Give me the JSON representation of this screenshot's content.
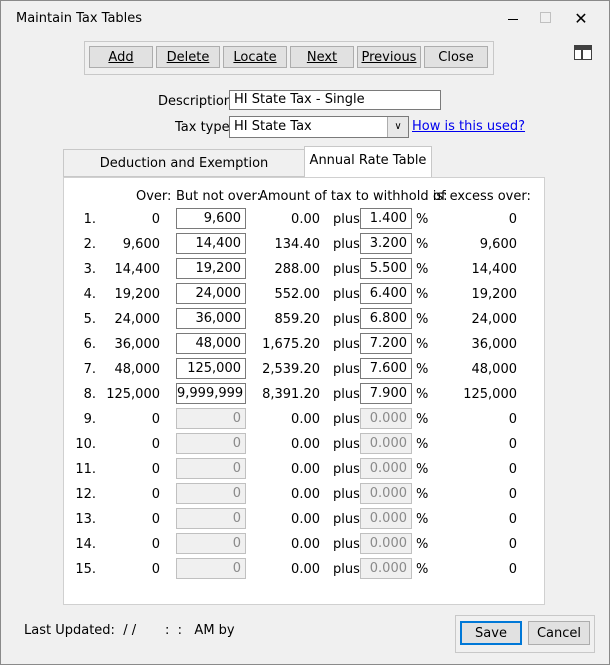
{
  "window": {
    "title": "Maintain Tax Tables",
    "close_glyph": "✕"
  },
  "toolbar": {
    "add": "Add",
    "delete": "Delete",
    "locate": "Locate",
    "next": "Next",
    "previous": "Previous",
    "close": "Close"
  },
  "form": {
    "description_label": "Description:",
    "description_value": "HI State Tax - Single",
    "tax_type_label": "Tax type:",
    "tax_type_value": "HI State Tax",
    "how_used_link": "How is this used?"
  },
  "tabs": [
    {
      "label": "Deduction and Exemption Information",
      "active": false
    },
    {
      "label": "Annual Rate Table",
      "active": true
    }
  ],
  "rate_table": {
    "headers": {
      "over": "Over:",
      "but_not_over": "But not over:",
      "amount": "Amount of tax to withhold is:",
      "of_excess": "of excess over:"
    },
    "plus_label": "plus",
    "percent_label": "%",
    "rows": [
      {
        "num": "1.",
        "over": "0",
        "not_over": "9,600",
        "amount": "0.00",
        "rate": "1.400",
        "excess": "0",
        "enabled": true
      },
      {
        "num": "2.",
        "over": "9,600",
        "not_over": "14,400",
        "amount": "134.40",
        "rate": "3.200",
        "excess": "9,600",
        "enabled": true
      },
      {
        "num": "3.",
        "over": "14,400",
        "not_over": "19,200",
        "amount": "288.00",
        "rate": "5.500",
        "excess": "14,400",
        "enabled": true
      },
      {
        "num": "4.",
        "over": "19,200",
        "not_over": "24,000",
        "amount": "552.00",
        "rate": "6.400",
        "excess": "19,200",
        "enabled": true
      },
      {
        "num": "5.",
        "over": "24,000",
        "not_over": "36,000",
        "amount": "859.20",
        "rate": "6.800",
        "excess": "24,000",
        "enabled": true
      },
      {
        "num": "6.",
        "over": "36,000",
        "not_over": "48,000",
        "amount": "1,675.20",
        "rate": "7.200",
        "excess": "36,000",
        "enabled": true
      },
      {
        "num": "7.",
        "over": "48,000",
        "not_over": "125,000",
        "amount": "2,539.20",
        "rate": "7.600",
        "excess": "48,000",
        "enabled": true
      },
      {
        "num": "8.",
        "over": "125,000",
        "not_over": "9,999,999",
        "amount": "8,391.20",
        "rate": "7.900",
        "excess": "125,000",
        "enabled": true
      },
      {
        "num": "9.",
        "over": "0",
        "not_over": "0",
        "amount": "0.00",
        "rate": "0.000",
        "excess": "0",
        "enabled": false
      },
      {
        "num": "10.",
        "over": "0",
        "not_over": "0",
        "amount": "0.00",
        "rate": "0.000",
        "excess": "0",
        "enabled": false
      },
      {
        "num": "11.",
        "over": "0",
        "not_over": "0",
        "amount": "0.00",
        "rate": "0.000",
        "excess": "0",
        "enabled": false
      },
      {
        "num": "12.",
        "over": "0",
        "not_over": "0",
        "amount": "0.00",
        "rate": "0.000",
        "excess": "0",
        "enabled": false
      },
      {
        "num": "13.",
        "over": "0",
        "not_over": "0",
        "amount": "0.00",
        "rate": "0.000",
        "excess": "0",
        "enabled": false
      },
      {
        "num": "14.",
        "over": "0",
        "not_over": "0",
        "amount": "0.00",
        "rate": "0.000",
        "excess": "0",
        "enabled": false
      },
      {
        "num": "15.",
        "over": "0",
        "not_over": "0",
        "amount": "0.00",
        "rate": "0.000",
        "excess": "0",
        "enabled": false
      }
    ]
  },
  "footer": {
    "last_updated": "Last Updated:  / /       :  :   AM by",
    "save": "Save",
    "cancel": "Cancel"
  },
  "colors": {
    "window_bg": "#f0f0f0",
    "panel_bg": "#ffffff",
    "link": "#0000ee",
    "default_button_border": "#0078d7",
    "disabled_input_bg": "#f0f0f0"
  }
}
